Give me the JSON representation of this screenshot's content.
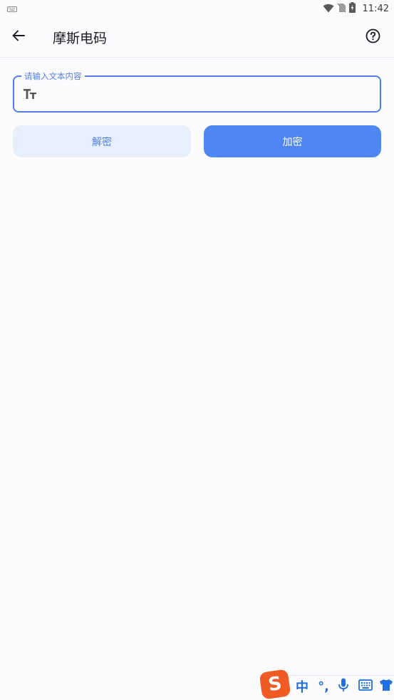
{
  "status_bar": {
    "time": "11:42",
    "icons": [
      "keyboard-icon",
      "wifi-icon",
      "no-sim-icon",
      "battery-charging-icon"
    ]
  },
  "app_bar": {
    "title": "摩斯电码",
    "back_icon": "arrow-left-icon",
    "help_icon": "help-circle-icon"
  },
  "input": {
    "label": "请输入文本内容",
    "value": "",
    "icon": "text-size-icon"
  },
  "buttons": {
    "decrypt": "解密",
    "encrypt": "加密"
  },
  "ime_toolbar": {
    "logo_letter": "S",
    "chinese_toggle": "中",
    "punctuation": "°,",
    "icons": [
      "voice-input-icon",
      "keyboard-layout-icon",
      "skin-shirt-icon"
    ]
  },
  "colors": {
    "accent": "#4f86f2",
    "accent_light": "#e7effd",
    "ime_blue": "#1f6fe0",
    "ime_logo": "#f05a24"
  }
}
